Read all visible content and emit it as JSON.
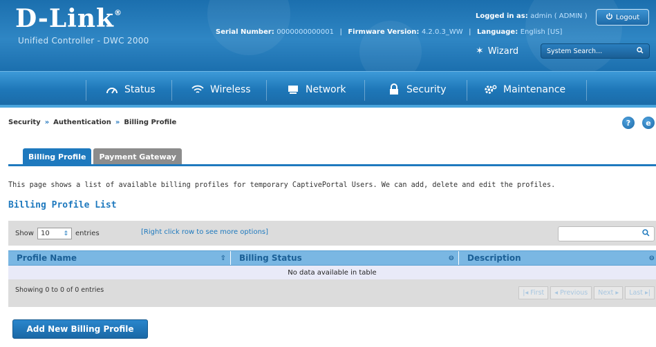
{
  "header": {
    "brand": "D-Link",
    "brand_mark": "®",
    "subtitle": "Unified Controller - DWC 2000",
    "serial_label": "Serial Number:",
    "serial_value": "0000000000001",
    "firmware_label": "Firmware Version:",
    "firmware_value": "4.2.0.3_WW",
    "language_label": "Language:",
    "language_value": "English [US]",
    "logged_in_label": "Logged in as:",
    "logged_in_value": "admin ( ADMIN )",
    "logout_label": "Logout",
    "wizard_label": "Wizard",
    "system_search_placeholder": "System Search..."
  },
  "nav": {
    "items": [
      {
        "label": "Status",
        "icon": "status-icon"
      },
      {
        "label": "Wireless",
        "icon": "wifi-icon"
      },
      {
        "label": "Network",
        "icon": "network-icon"
      },
      {
        "label": "Security",
        "icon": "lock-icon"
      },
      {
        "label": "Maintenance",
        "icon": "gear-icon"
      }
    ]
  },
  "breadcrumb": {
    "items": [
      "Security",
      "Authentication",
      "Billing Profile"
    ],
    "separator": "»"
  },
  "tabs": [
    {
      "label": "Billing Profile",
      "active": true
    },
    {
      "label": "Payment Gateway",
      "active": false
    }
  ],
  "page": {
    "description": "This page shows a list of available billing profiles for temporary CaptivePortal Users. We can add, delete and edit the profiles.",
    "section_title": "Billing Profile List"
  },
  "table": {
    "show_label": "Show",
    "entries_value": "10",
    "entries_label": "entries",
    "hint": "[Right click row to see more options]",
    "columns": [
      "Profile Name",
      "Billing Status",
      "Description"
    ],
    "empty_text": "No data available in table",
    "showing_text": "Showing 0 to 0 of 0 entries",
    "pager": [
      "First",
      "Previous",
      "Next",
      "Last"
    ]
  },
  "actions": {
    "add_button": "Add New Billing Profile"
  },
  "colors": {
    "header_blue": "#1b6fae",
    "accent_blue": "#1e79be",
    "table_header": "#7ab7e3",
    "empty_row": "#e9eaf8"
  }
}
